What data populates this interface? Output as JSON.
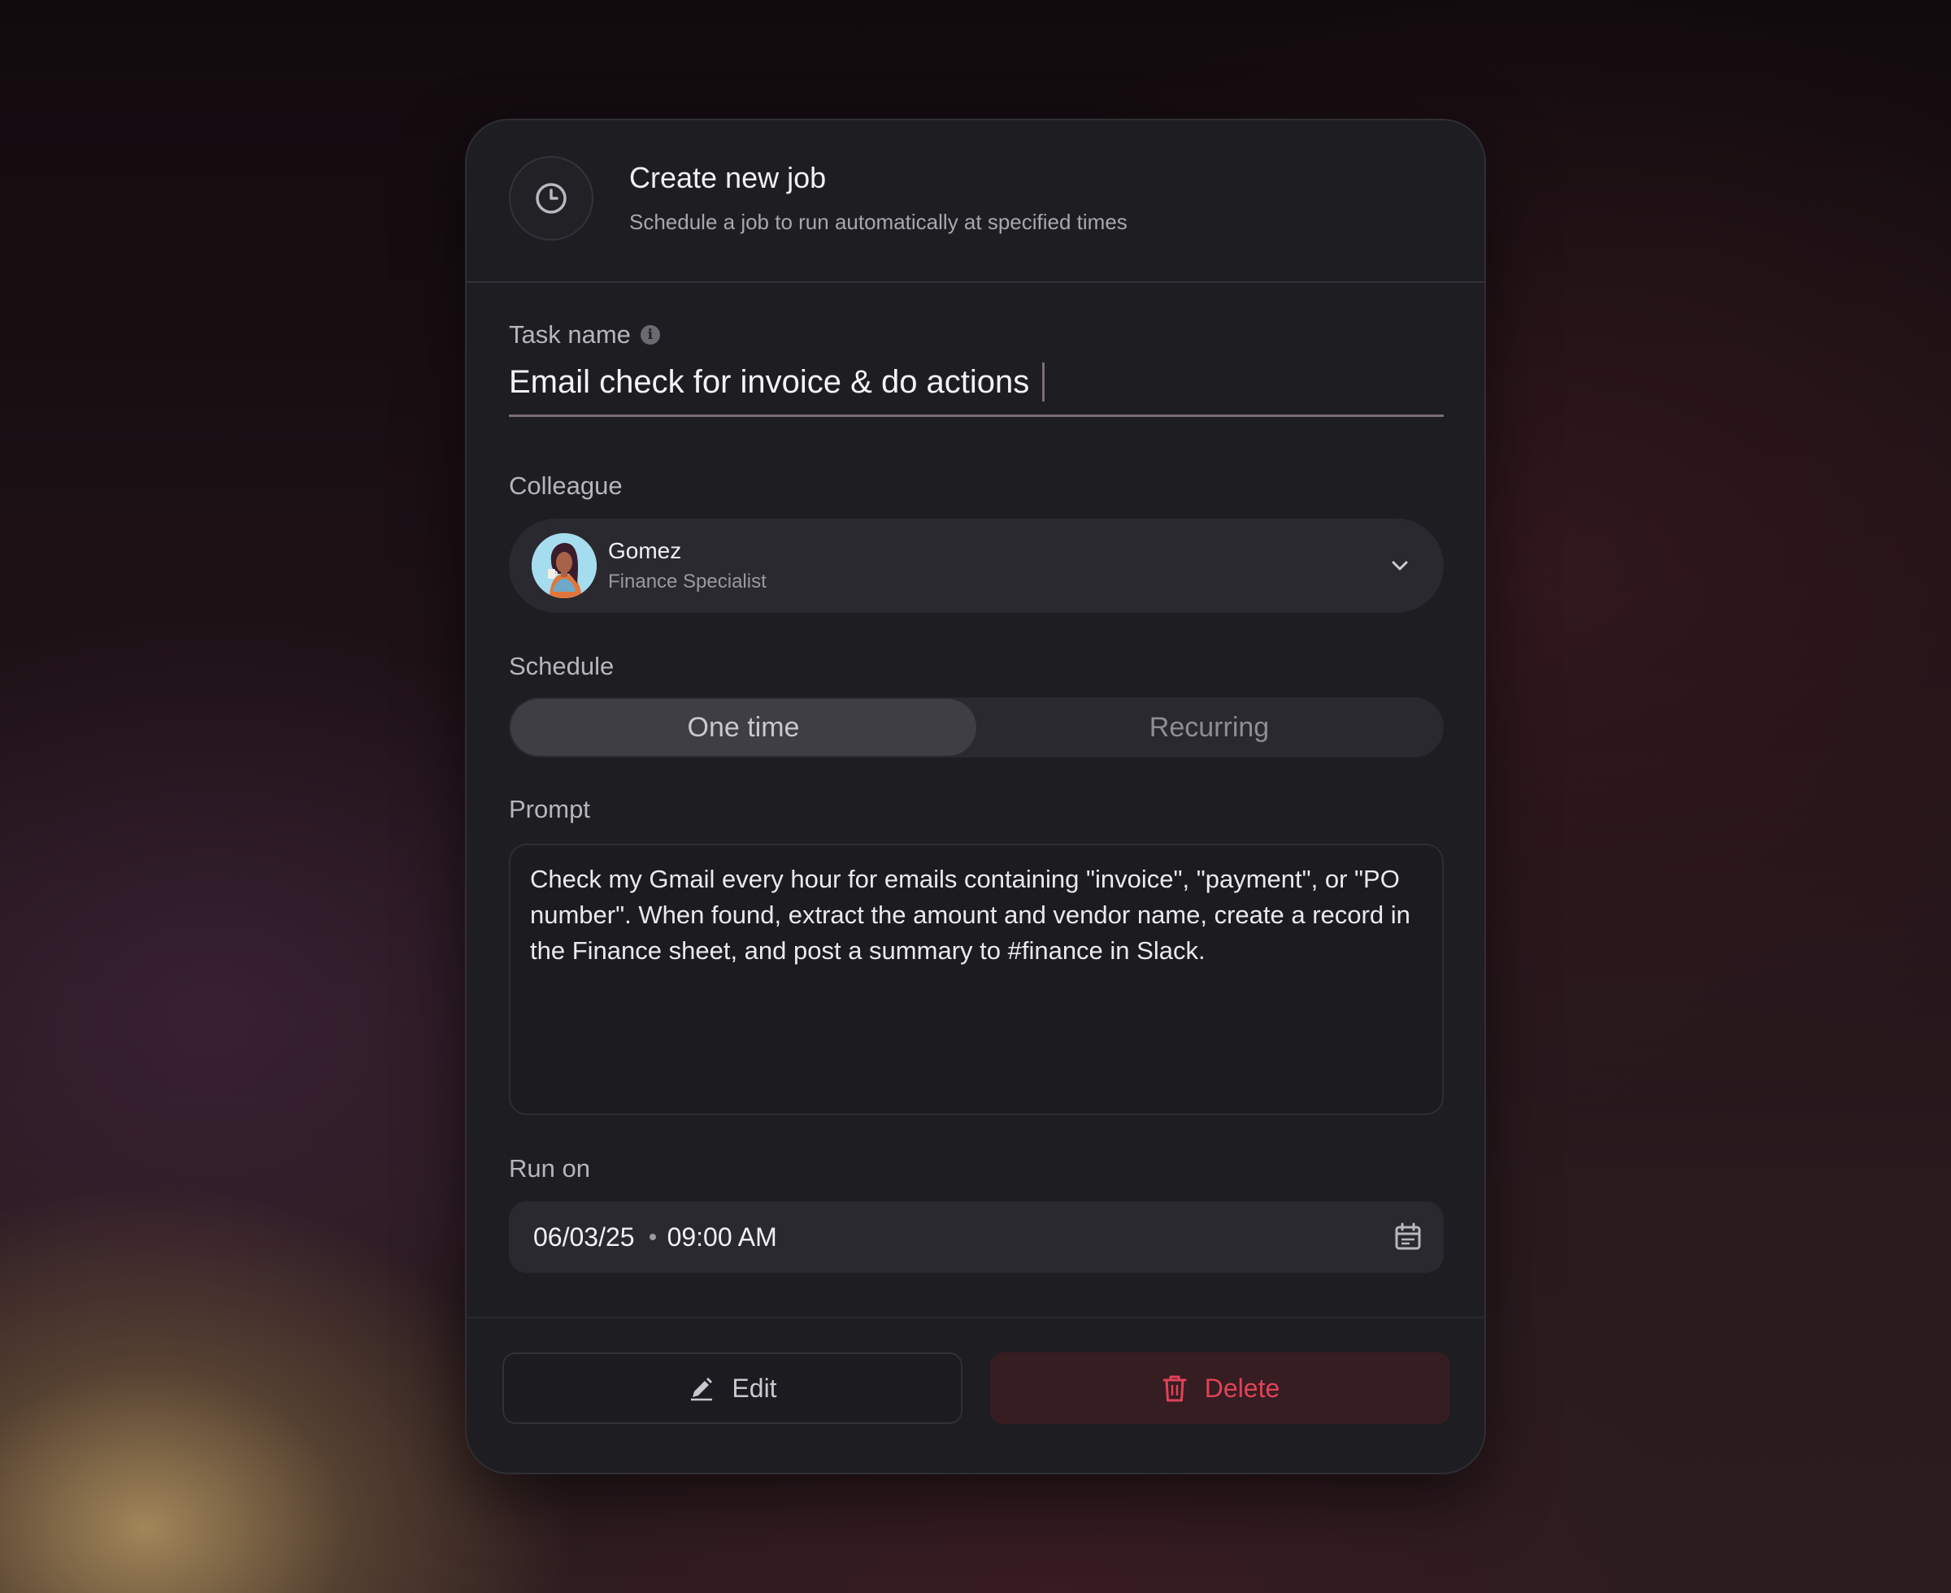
{
  "dialog": {
    "title": "Create new job",
    "subtitle": "Schedule a job to run automatically at specified times",
    "icon": "clock-icon"
  },
  "task": {
    "label": "Task name",
    "value": "Email check for invoice & do actions"
  },
  "colleague": {
    "label": "Colleague",
    "name": "Gomez",
    "role": "Finance Specialist"
  },
  "schedule": {
    "label": "Schedule",
    "options": [
      "One time",
      "Recurring"
    ],
    "selected": "One time"
  },
  "prompt": {
    "label": "Prompt",
    "value": "Check my Gmail every hour for emails containing \"invoice\", \"payment\", or \"PO number\". When found, extract the amount and vendor name, create a record in the Finance sheet, and post a summary to #finance in Slack."
  },
  "run_on": {
    "label": "Run on",
    "date": "06/03/25",
    "time": "09:00 AM"
  },
  "actions": {
    "edit_label": "Edit",
    "delete_label": "Delete"
  },
  "colors": {
    "card_bg": "#1e1d21",
    "field_bg": "#2a292f",
    "delete_text": "#e04358",
    "delete_bg": "#361d22"
  }
}
